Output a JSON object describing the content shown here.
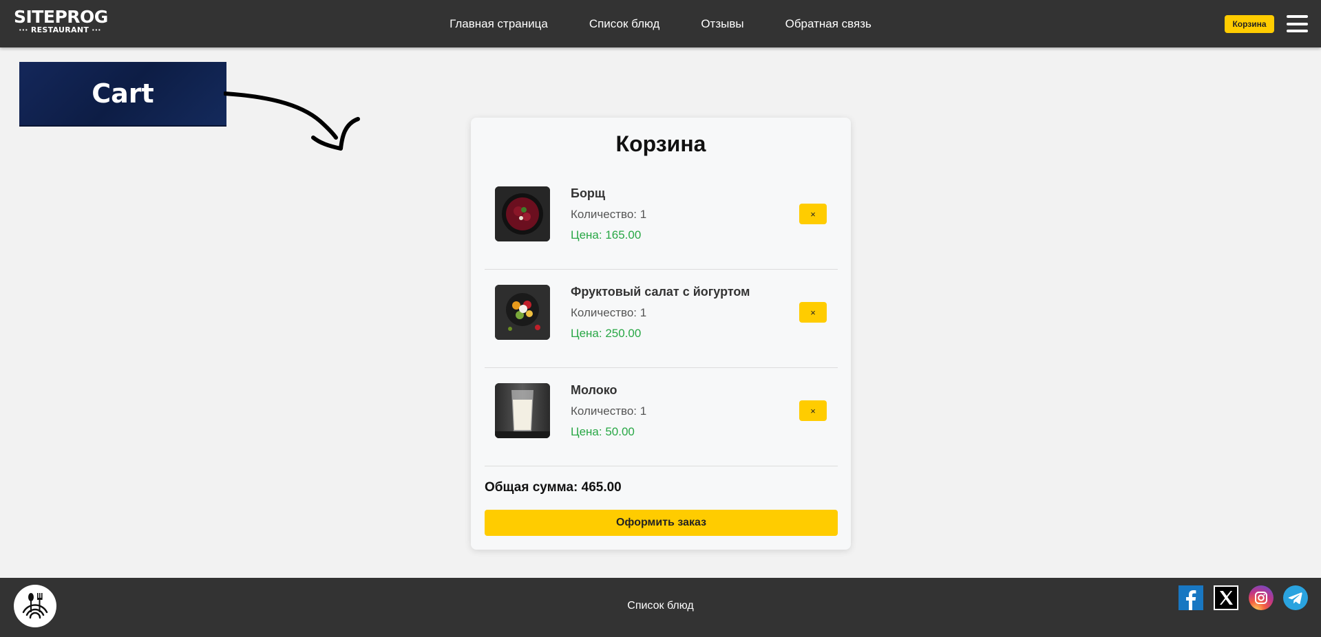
{
  "header": {
    "logo_main": "SITEPROG",
    "logo_sub": "··· RESTAURANT ···",
    "nav": [
      "Главная страница",
      "Список блюд",
      "Отзывы",
      "Обратная связь"
    ],
    "cart_button": "Корзина"
  },
  "annotation": {
    "label": "Cart"
  },
  "cart": {
    "title": "Корзина",
    "items": [
      {
        "name": "Борщ",
        "quantity": "Количество: 1",
        "price": "Цена: 165.00",
        "image": "borscht-image"
      },
      {
        "name": "Фруктовый салат с йогуртом",
        "quantity": "Количество: 1",
        "price": "Цена: 250.00",
        "image": "fruit-salad-image"
      },
      {
        "name": "Молоко",
        "quantity": "Количество: 1",
        "price": "Цена: 50.00",
        "image": "milk-image"
      }
    ],
    "remove_label": "×",
    "total": "Общая сумма: 465.00",
    "order_button": "Оформить заказ"
  },
  "footer": {
    "link": "Список блюд",
    "social": [
      "facebook-icon",
      "x-icon",
      "instagram-icon",
      "telegram-icon"
    ]
  },
  "colors": {
    "header_bg": "#333333",
    "accent": "#ffcc00",
    "price": "#28a745",
    "page_bg": "#f2f2f2",
    "sign_bg": "#0d1d45"
  }
}
